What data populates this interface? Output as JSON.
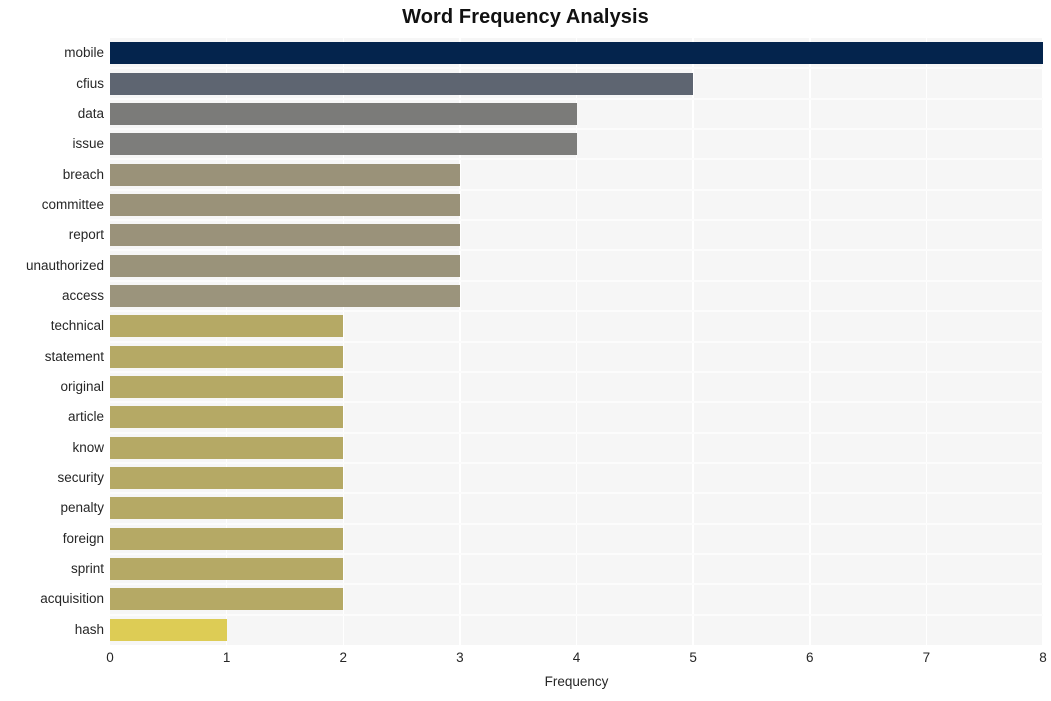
{
  "chart_data": {
    "type": "bar",
    "orientation": "horizontal",
    "title": "Word Frequency Analysis",
    "xlabel": "Frequency",
    "ylabel": "",
    "categories": [
      "mobile",
      "cfius",
      "data",
      "issue",
      "breach",
      "committee",
      "report",
      "unauthorized",
      "access",
      "technical",
      "statement",
      "original",
      "article",
      "know",
      "security",
      "penalty",
      "foreign",
      "sprint",
      "acquisition",
      "hash"
    ],
    "values": [
      8,
      5,
      4,
      4,
      3,
      3,
      3,
      3,
      3,
      2,
      2,
      2,
      2,
      2,
      2,
      2,
      2,
      2,
      2,
      1
    ],
    "bar_colors": [
      "#04244d",
      "#5e6571",
      "#7b7b79",
      "#7d7d7b",
      "#9a9279",
      "#9a9279",
      "#9a927a",
      "#9a937a",
      "#9b947c",
      "#b5a965",
      "#b5a965",
      "#b5a965",
      "#b5a965",
      "#b5a965",
      "#b5a965",
      "#b5a965",
      "#b5a965",
      "#b5a965",
      "#b5a965",
      "#ddcc55"
    ],
    "xlim": [
      0,
      8
    ],
    "xticks": [
      0,
      1,
      2,
      3,
      4,
      5,
      6,
      7,
      8
    ],
    "xticklabels": [
      "0",
      "1",
      "2",
      "3",
      "4",
      "5",
      "6",
      "7",
      "8"
    ],
    "grid": true,
    "grid_axis": "both",
    "legend": "none",
    "plot_background": "#f6f6f6",
    "figure_background": "#ffffff",
    "gridline_color": "#ffffff",
    "tick_label_color": "#262626",
    "title_color": "#111111"
  }
}
